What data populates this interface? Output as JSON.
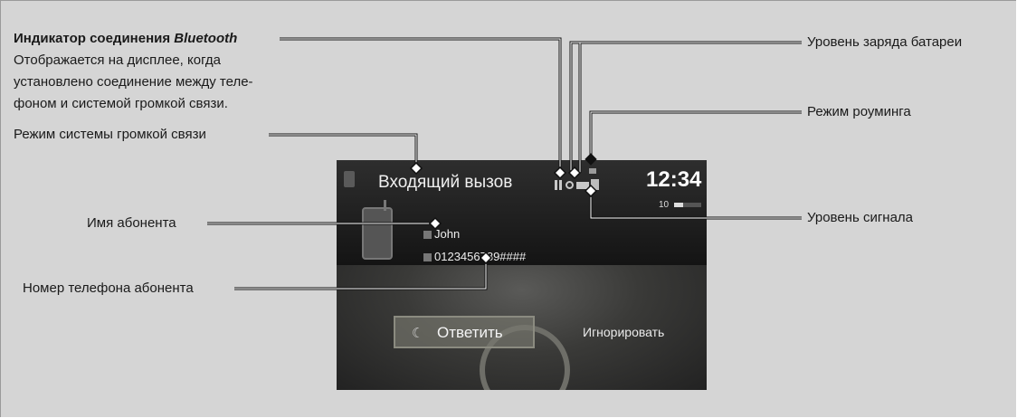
{
  "callouts": {
    "bt_title": "Индикатор соединения",
    "bt_title_em": "Bluetooth",
    "bt_desc_1": "Отображается на дисплее, когда",
    "bt_desc_2": "установлено соединение между теле-",
    "bt_desc_3": "фоном и системой громкой связи.",
    "hf_mode": "Режим системы громкой связи",
    "caller_name": "Имя абонента",
    "caller_number": "Номер телефона абонента",
    "battery": "Уровень заряда батареи",
    "roaming": "Режим роуминга",
    "signal": "Уровень сигнала"
  },
  "screen": {
    "title": "Входящий вызов",
    "clock": "12:34",
    "volume": "10",
    "caller_name": "John",
    "caller_number": "0123456789####",
    "answer_label": "Ответить",
    "ignore_label": "Игнорировать"
  }
}
